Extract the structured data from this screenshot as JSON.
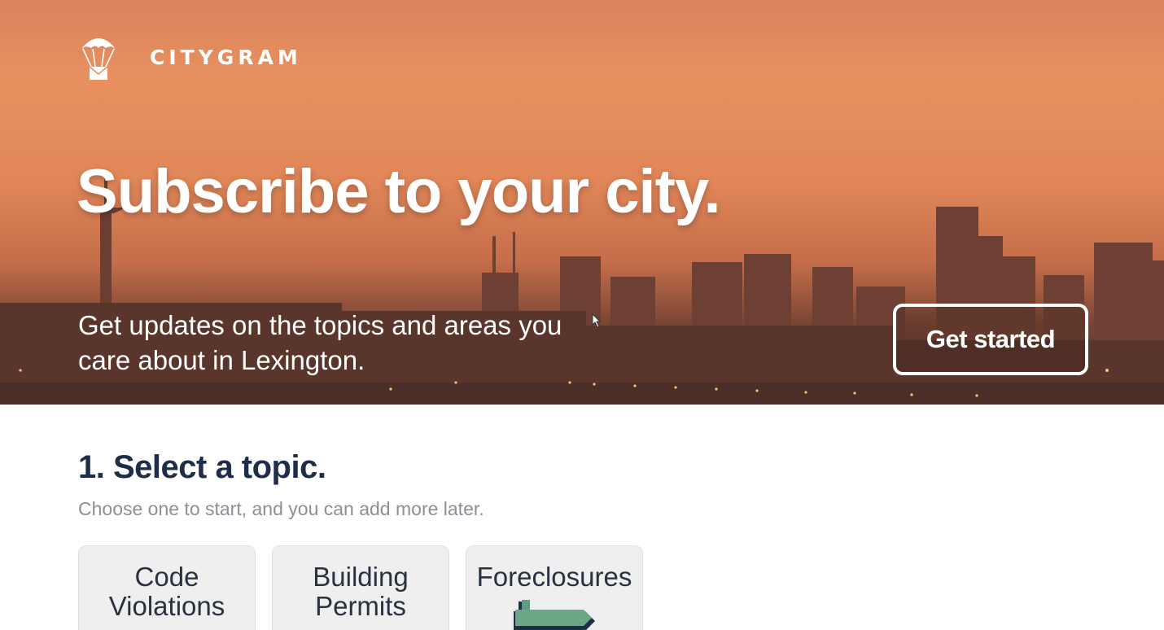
{
  "brand": {
    "name": "CITYGRAM",
    "logo_icon": "parachute-envelope-icon"
  },
  "hero": {
    "title": "Subscribe to your city.",
    "subtitle": "Get updates on the topics and areas you care about in Lexington.",
    "cta_label": "Get started"
  },
  "topics_section": {
    "title": "1. Select a topic.",
    "subtitle": "Choose one to start, and you can add more later.",
    "topics": [
      {
        "label": "Code Violations"
      },
      {
        "label": "Building Permits"
      },
      {
        "label": "Foreclosures",
        "icon": "signpost-icon"
      }
    ]
  },
  "colors": {
    "hero_sky": "#e8915f",
    "heading": "#1f2e48",
    "muted_text": "#8a9096",
    "card_bg": "#efefef"
  }
}
